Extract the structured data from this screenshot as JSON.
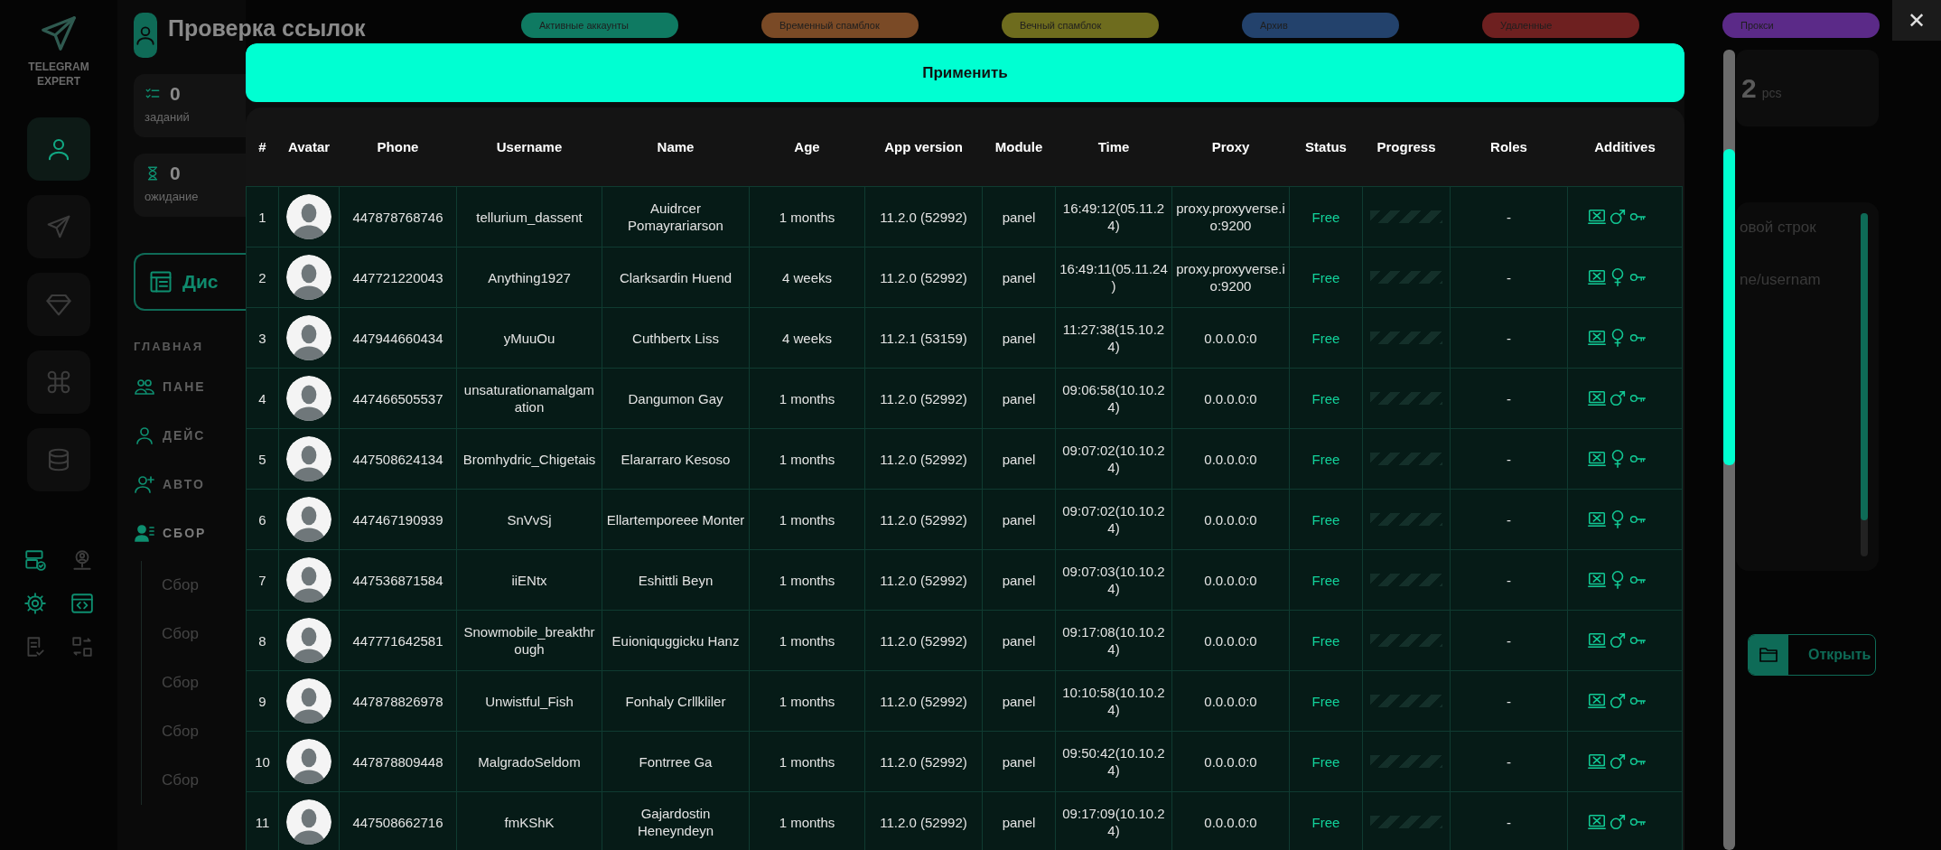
{
  "sidebar": {
    "logo_text": "TELEGRAM EXPERT",
    "nav": [
      {
        "selected": true
      },
      {
        "selected": false
      },
      {
        "selected": false
      },
      {
        "selected": false
      },
      {
        "selected": false
      }
    ],
    "tools": [
      {
        "active": true
      },
      {
        "active": false
      },
      {
        "active": true
      },
      {
        "active": true
      },
      {
        "active": false
      },
      {
        "active": false
      }
    ]
  },
  "panel": {
    "title": "Проверка ссылок",
    "stats": [
      {
        "value": "0",
        "label": "заданий"
      },
      {
        "value": "0",
        "label": "ожидание"
      }
    ],
    "action_button": "Дис",
    "section_title": "ГЛАВНАЯ",
    "menu": [
      {
        "label": "ПАНЕ",
        "selected": false
      },
      {
        "label": "ДЕЙС",
        "selected": false
      },
      {
        "label": "АВТО",
        "selected": false
      },
      {
        "label": "СБОР",
        "selected": true
      }
    ],
    "submenu": [
      "Сбор",
      "Сбор",
      "Сбор",
      "Сбор",
      "Сбор"
    ]
  },
  "legend": [
    {
      "label": "Активные аккаунты",
      "color": "#0f7a62"
    },
    {
      "label": "Временный спамблок",
      "color": "#7a4a26"
    },
    {
      "label": "Вечный спамблок",
      "color": "#6e6c1e"
    },
    {
      "label": "Архив",
      "color": "#23426c"
    },
    {
      "label": "Удаленные",
      "color": "#6e2020"
    },
    {
      "label": "Прокси",
      "color": "#5b2a88"
    }
  ],
  "right_panel": {
    "count": "2",
    "count_unit": "pcs",
    "placeholder_fragments": [
      "овой строк",
      "ne/usernam"
    ],
    "open_button": "Открыть"
  },
  "close_button": "✕",
  "modal": {
    "apply_button": "Применить",
    "table": {
      "columns": [
        "#",
        "Avatar",
        "Phone",
        "Username",
        "Name",
        "Age",
        "App version",
        "Module",
        "Time",
        "Proxy",
        "Status",
        "Progress",
        "Roles",
        "Additives"
      ],
      "rows": [
        {
          "n": "1",
          "phone": "447878768746",
          "username": "tellurium_dassent",
          "name": "Auidrcer Pomayrariarson",
          "age": "1 months",
          "app_version": "11.2.0 (52992)",
          "module": "panel",
          "time": "16:49:12(05.11.24)",
          "proxy": "proxy.proxyverse.io:9200",
          "status": "Free",
          "level": 0,
          "roles": "-",
          "kind": "male"
        },
        {
          "n": "2",
          "phone": "447721220043",
          "username": "Anything1927",
          "name": "Clarksardin Huend",
          "age": "4 weeks",
          "app_version": "11.2.0 (52992)",
          "module": "panel",
          "time": "16:49:11(05.11.24)",
          "proxy": "proxy.proxyverse.io:9200",
          "status": "Free",
          "level": 0,
          "roles": "-",
          "kind": "female"
        },
        {
          "n": "3",
          "phone": "447944660434",
          "username": "yMuuOu",
          "name": "Cuthbertx Liss",
          "age": "4 weeks",
          "app_version": "11.2.1 (53159)",
          "module": "panel",
          "time": "11:27:38(15.10.24)",
          "proxy": "0.0.0.0:0",
          "status": "Free",
          "level": 0,
          "roles": "-",
          "kind": "female"
        },
        {
          "n": "4",
          "phone": "447466505537",
          "username": "unsaturationamalgamation",
          "name": "Dangumon Gay",
          "age": "1 months",
          "app_version": "11.2.0 (52992)",
          "module": "panel",
          "time": "09:06:58(10.10.24)",
          "proxy": "0.0.0.0:0",
          "status": "Free",
          "level": 0,
          "roles": "-",
          "kind": "male"
        },
        {
          "n": "5",
          "phone": "447508624134",
          "username": "Bromhydric_Chigetais",
          "name": "Elararraro Kesoso",
          "age": "1 months",
          "app_version": "11.2.0 (52992)",
          "module": "panel",
          "time": "09:07:02(10.10.24)",
          "proxy": "0.0.0.0:0",
          "status": "Free",
          "level": 0,
          "roles": "-",
          "kind": "female"
        },
        {
          "n": "6",
          "phone": "447467190939",
          "username": "SnVvSj",
          "name": "Ellartemporeee Monter",
          "age": "1 months",
          "app_version": "11.2.0 (52992)",
          "module": "panel",
          "time": "09:07:02(10.10.24)",
          "proxy": "0.0.0.0:0",
          "status": "Free",
          "level": 0,
          "roles": "-",
          "kind": "female"
        },
        {
          "n": "7",
          "phone": "447536871584",
          "username": "iiENtx",
          "name": "Eshittli Beyn",
          "age": "1 months",
          "app_version": "11.2.0 (52992)",
          "module": "panel",
          "time": "09:07:03(10.10.24)",
          "proxy": "0.0.0.0:0",
          "status": "Free",
          "level": 0,
          "roles": "-",
          "kind": "female"
        },
        {
          "n": "8",
          "phone": "447771642581",
          "username": "Snowmobile_breakthrough",
          "name": "Euioniquggicku Hanz",
          "age": "1 months",
          "app_version": "11.2.0 (52992)",
          "module": "panel",
          "time": "09:17:08(10.10.24)",
          "proxy": "0.0.0.0:0",
          "status": "Free",
          "level": 0,
          "roles": "-",
          "kind": "male"
        },
        {
          "n": "9",
          "phone": "447878826978",
          "username": "Unwistful_Fish",
          "name": "Fonhaly Crllkliler",
          "age": "1 months",
          "app_version": "11.2.0 (52992)",
          "module": "panel",
          "time": "10:10:58(10.10.24)",
          "proxy": "0.0.0.0:0",
          "status": "Free",
          "level": 0,
          "roles": "-",
          "kind": "male"
        },
        {
          "n": "10",
          "phone": "447878809448",
          "username": "MalgradoSeldom",
          "name": "Fontrree Ga",
          "age": "1 months",
          "app_version": "11.2.0 (52992)",
          "module": "panel",
          "time": "09:50:42(10.10.24)",
          "proxy": "0.0.0.0:0",
          "status": "Free",
          "level": 0,
          "roles": "-",
          "kind": "male"
        },
        {
          "n": "11",
          "phone": "447508662716",
          "username": "fmKShK",
          "name": "Gajardostin Heneyndeyn",
          "age": "1 months",
          "app_version": "11.2.0 (52992)",
          "module": "panel",
          "time": "09:17:09(10.10.24)",
          "proxy": "0.0.0.0:0",
          "status": "Free",
          "level": 0,
          "roles": "-",
          "kind": "male"
        }
      ]
    }
  }
}
